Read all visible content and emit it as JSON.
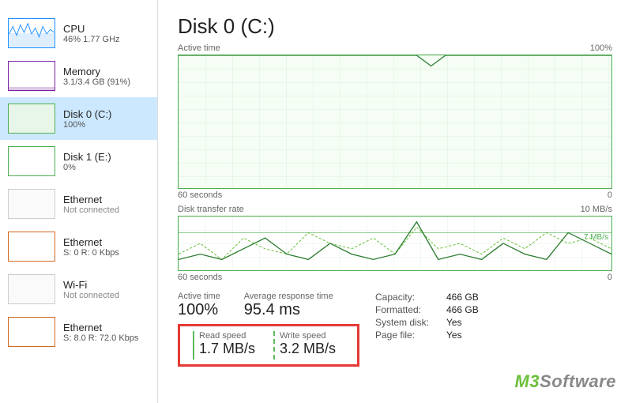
{
  "sidebar": {
    "items": [
      {
        "title": "CPU",
        "sub": "46% 1.77 GHz",
        "muted": false
      },
      {
        "title": "Memory",
        "sub": "3.1/3.4 GB (91%)",
        "muted": false
      },
      {
        "title": "Disk 0 (C:)",
        "sub": "100%",
        "muted": false
      },
      {
        "title": "Disk 1 (E:)",
        "sub": "0%",
        "muted": false
      },
      {
        "title": "Ethernet",
        "sub": "Not connected",
        "muted": true
      },
      {
        "title": "Ethernet",
        "sub": "S: 0 R: 0 Kbps",
        "muted": false
      },
      {
        "title": "Wi-Fi",
        "sub": "Not connected",
        "muted": true
      },
      {
        "title": "Ethernet",
        "sub": "S: 8.0 R: 72.0 Kbps",
        "muted": false
      }
    ]
  },
  "main": {
    "title": "Disk 0 (C:)",
    "chart_active": {
      "head_left": "Active time",
      "head_right": "100%",
      "foot_left": "60 seconds",
      "foot_right": "0"
    },
    "chart_transfer": {
      "head_left": "Disk transfer rate",
      "head_right": "10 MB/s",
      "foot_left": "60 seconds",
      "foot_right": "0",
      "line7_label": "7 MB/s"
    },
    "stats": {
      "active_time_label": "Active time",
      "active_time_value": "100%",
      "avg_resp_label": "Average response time",
      "avg_resp_value": "95.4 ms",
      "read_label": "Read speed",
      "read_value": "1.7 MB/s",
      "write_label": "Write speed",
      "write_value": "3.2 MB/s"
    },
    "info": {
      "capacity_key": "Capacity:",
      "capacity_val": "466 GB",
      "formatted_key": "Formatted:",
      "formatted_val": "466 GB",
      "sysdisk_key": "System disk:",
      "sysdisk_val": "Yes",
      "pagefile_key": "Page file:",
      "pagefile_val": "Yes"
    }
  },
  "watermark": {
    "brand_prefix": "M3",
    "brand_suffix": "Software"
  },
  "chart_data": [
    {
      "type": "line",
      "title": "Active time",
      "xlabel": "60 seconds → 0",
      "ylabel": "Active time %",
      "ylim": [
        0,
        100
      ],
      "x": [
        0,
        5,
        10,
        15,
        20,
        25,
        30,
        33,
        35,
        37,
        40,
        45,
        50,
        55,
        60
      ],
      "values": [
        100,
        100,
        100,
        100,
        100,
        100,
        100,
        100,
        92,
        100,
        100,
        100,
        100,
        100,
        100
      ]
    },
    {
      "type": "line",
      "title": "Disk transfer rate",
      "xlabel": "60 seconds → 0",
      "ylabel": "MB/s",
      "ylim": [
        0,
        10
      ],
      "series": [
        {
          "name": "Write speed",
          "style": "dashed",
          "x": [
            0,
            3,
            6,
            9,
            12,
            15,
            18,
            21,
            24,
            27,
            30,
            33,
            36,
            39,
            42,
            45,
            48,
            51,
            54,
            57,
            60
          ],
          "values": [
            3,
            5,
            2,
            6,
            4,
            3,
            7,
            5,
            4,
            6,
            3,
            8,
            4,
            5,
            3,
            6,
            4,
            7,
            5,
            6,
            4
          ]
        },
        {
          "name": "Read speed",
          "style": "solid",
          "x": [
            0,
            3,
            6,
            9,
            12,
            15,
            18,
            21,
            24,
            27,
            30,
            33,
            36,
            39,
            42,
            45,
            48,
            51,
            54,
            57,
            60
          ],
          "values": [
            2,
            3,
            2,
            4,
            6,
            3,
            2,
            5,
            3,
            2,
            3,
            9,
            2,
            3,
            2,
            5,
            3,
            2,
            7,
            5,
            3
          ]
        }
      ]
    }
  ]
}
